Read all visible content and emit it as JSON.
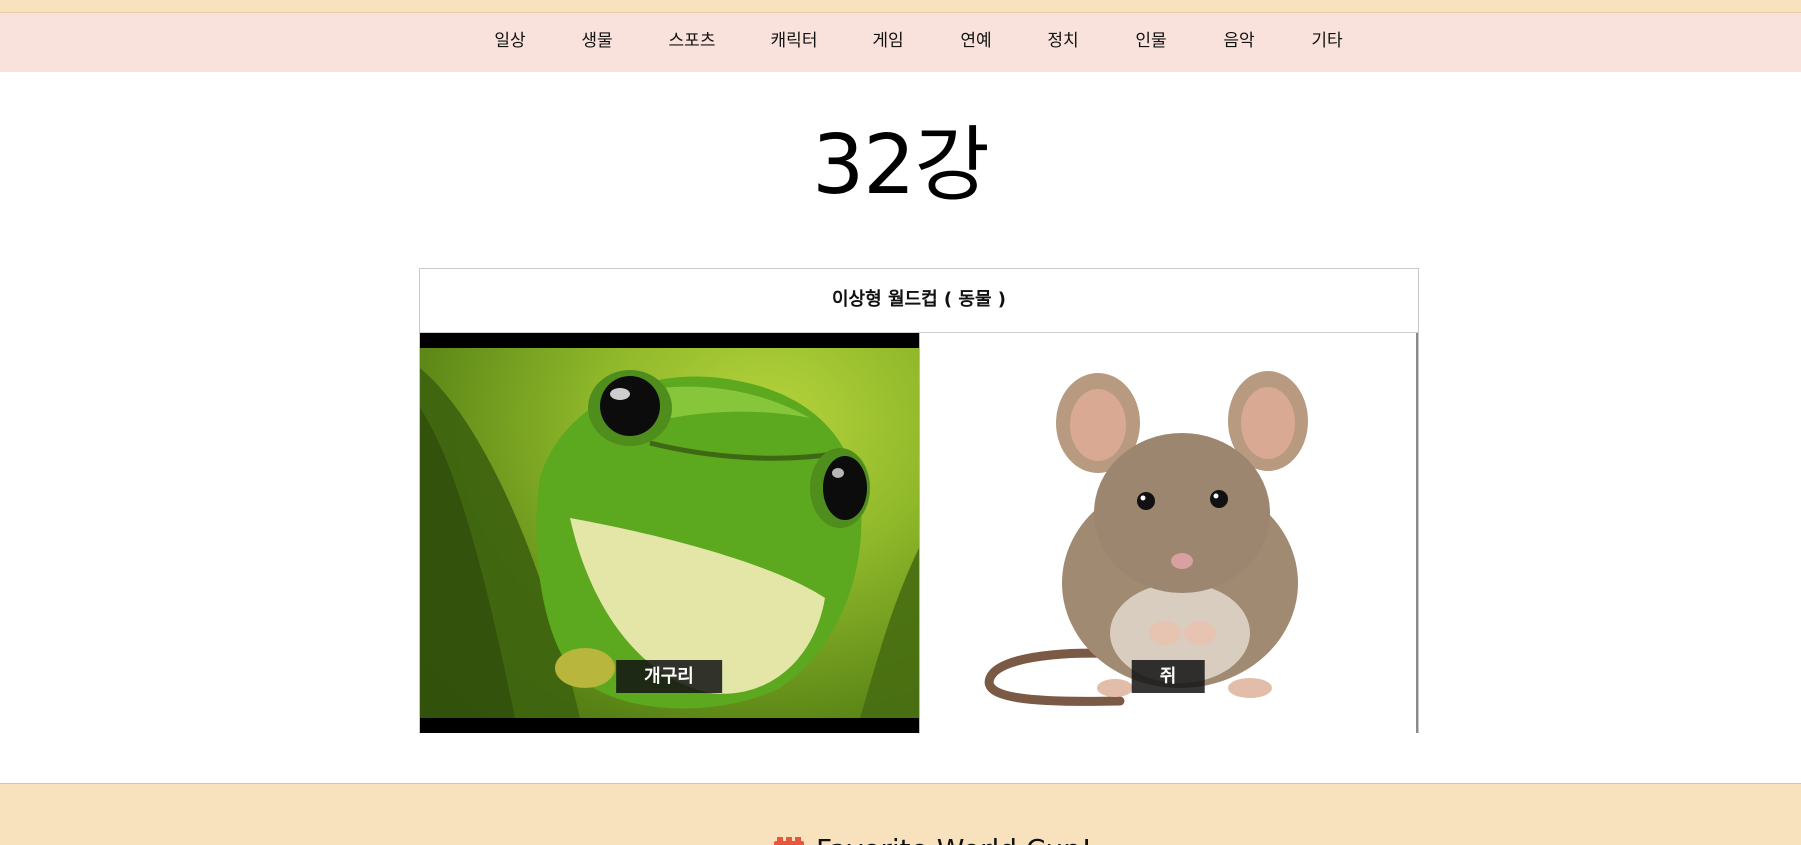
{
  "nav": {
    "items": [
      {
        "label": "일상"
      },
      {
        "label": "생물"
      },
      {
        "label": "스포츠"
      },
      {
        "label": "캐릭터"
      },
      {
        "label": "게임"
      },
      {
        "label": "연예"
      },
      {
        "label": "정치"
      },
      {
        "label": "인물"
      },
      {
        "label": "음악"
      },
      {
        "label": "기타"
      }
    ]
  },
  "page": {
    "round_title": "32강"
  },
  "worldcup": {
    "title": "이상형 월드컵 ( 동물 )",
    "candidates": [
      {
        "label": "개구리",
        "image": "frog-photo"
      },
      {
        "label": "쥐",
        "image": "mouse-photo"
      }
    ]
  },
  "footer": {
    "brand": "Favorite World Cup!",
    "brand_icon": "logo-icon"
  },
  "colors": {
    "top_strip": "#f8e2bd",
    "nav_background": "#f9e2dc",
    "footer_background": "#f8e2bd",
    "label_background": "#141414"
  }
}
